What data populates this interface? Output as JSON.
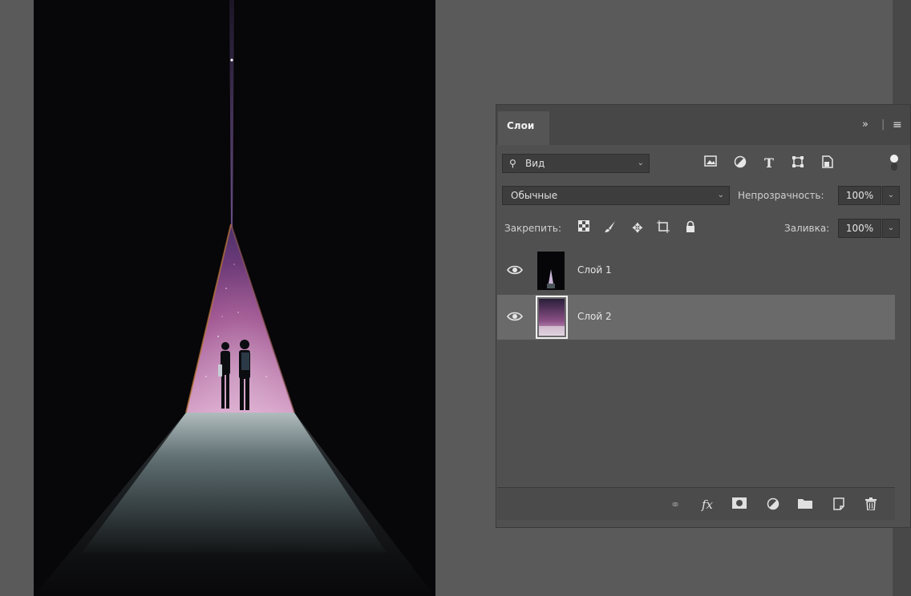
{
  "layers_panel": {
    "tab_title": "Слои",
    "collapse_icon": "double-chevron-right-icon",
    "menu_icon": "hamburger-menu-icon",
    "filter": {
      "search_icon": "search-icon",
      "kind_label": "Вид",
      "filter_icons": [
        "image-filter-icon",
        "adjustment-filter-icon",
        "type-filter-icon",
        "shape-filter-icon",
        "smart-object-filter-icon"
      ],
      "toggle_icon": "filter-toggle-icon"
    },
    "blend": {
      "mode": "Обычные",
      "opacity_label": "Непрозрачность:",
      "opacity_value": "100%"
    },
    "lock": {
      "label": "Закрепить:",
      "icons": [
        "lock-transparent-pixels-icon",
        "lock-image-pixels-icon",
        "lock-position-icon",
        "lock-artboard-icon",
        "lock-all-icon"
      ],
      "fill_label": "Заливка:",
      "fill_value": "100%"
    },
    "layers": [
      {
        "name": "Слой 1",
        "visible": true,
        "selected": false
      },
      {
        "name": "Слой 2",
        "visible": true,
        "selected": true
      }
    ],
    "footer_icons": [
      "link-layers-icon",
      "fx-icon",
      "add-mask-icon",
      "adjustment-layer-icon",
      "group-folder-icon",
      "new-layer-icon",
      "trash-icon"
    ],
    "footer_fx_label": "fx"
  },
  "colors": {
    "workspace": "#5a5a5a",
    "panel": "#505050",
    "selected_layer": "#6a6a6a",
    "canvas_bg": "#070608"
  }
}
